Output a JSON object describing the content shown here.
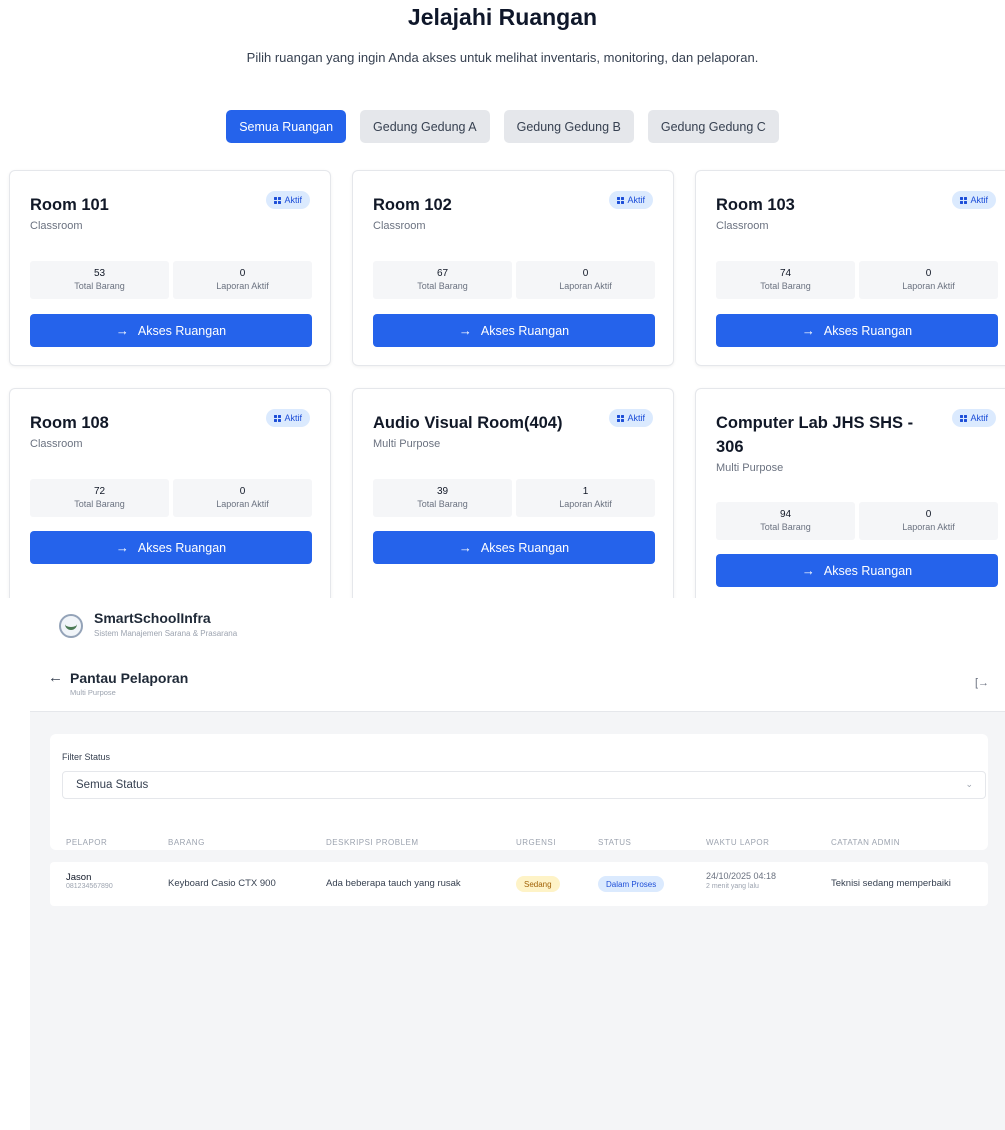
{
  "explore": {
    "title": "Jelajahi Ruangan",
    "subtitle": "Pilih ruangan yang ingin Anda akses untuk melihat inventaris, monitoring, dan pelaporan.",
    "filters": [
      "Semua Ruangan",
      "Gedung Gedung A",
      "Gedung Gedung B",
      "Gedung Gedung C"
    ],
    "active_filter": "Semua Ruangan",
    "badge_label": "Aktif",
    "stat_labels": {
      "total": "Total Barang",
      "reports": "Laporan Aktif"
    },
    "access_label": "Akses Ruangan",
    "rooms": [
      {
        "name": "Room 101",
        "type": "Classroom",
        "total": "53",
        "reports": "0"
      },
      {
        "name": "Room 102",
        "type": "Classroom",
        "total": "67",
        "reports": "0"
      },
      {
        "name": "Room 103",
        "type": "Classroom",
        "total": "74",
        "reports": "0"
      },
      {
        "name": "Room 108",
        "type": "Classroom",
        "total": "72",
        "reports": "0"
      },
      {
        "name": "Audio Visual Room(404)",
        "type": "Multi Purpose",
        "total": "39",
        "reports": "1"
      },
      {
        "name": "Computer Lab JHS SHS - 306",
        "type": "Multi Purpose",
        "total": "94",
        "reports": "0"
      }
    ]
  },
  "app": {
    "name": "SmartSchoolInfra",
    "tagline": "Sistem Manajemen Sarana & Prasarana"
  },
  "monitor": {
    "title": "Pantau Pelaporan",
    "subtitle": "Multi Purpose",
    "filter_label": "Filter Status",
    "filter_value": "Semua Status",
    "columns": [
      "PELAPOR",
      "BARANG",
      "DESKRIPSI PROBLEM",
      "URGENSI",
      "STATUS",
      "WAKTU LAPOR",
      "CATATAN ADMIN"
    ],
    "rows": [
      {
        "reporter": "Jason",
        "reporter_id": "081234567890",
        "item": "Keyboard Casio CTX 900",
        "problem": "Ada beberapa tauch yang rusak",
        "urgency": "Sedang",
        "status": "Dalam Proses",
        "time": "24/10/2025 04:18",
        "time_ago": "2 menit yang lalu",
        "note": "Teknisi sedang memperbaiki"
      }
    ]
  },
  "colors": {
    "primary": "#2563eb",
    "badge_bg": "#dbeafe",
    "urgency_bg": "#fef3c7",
    "urgency_text": "#a16207",
    "status_bg": "#dbeafe",
    "status_text": "#1d4ed8"
  },
  "icons": {
    "active": "grid-icon",
    "access": "arrow-right-icon",
    "back": "arrow-left-icon",
    "logout": "logout-icon",
    "select": "chevron-down-icon"
  }
}
